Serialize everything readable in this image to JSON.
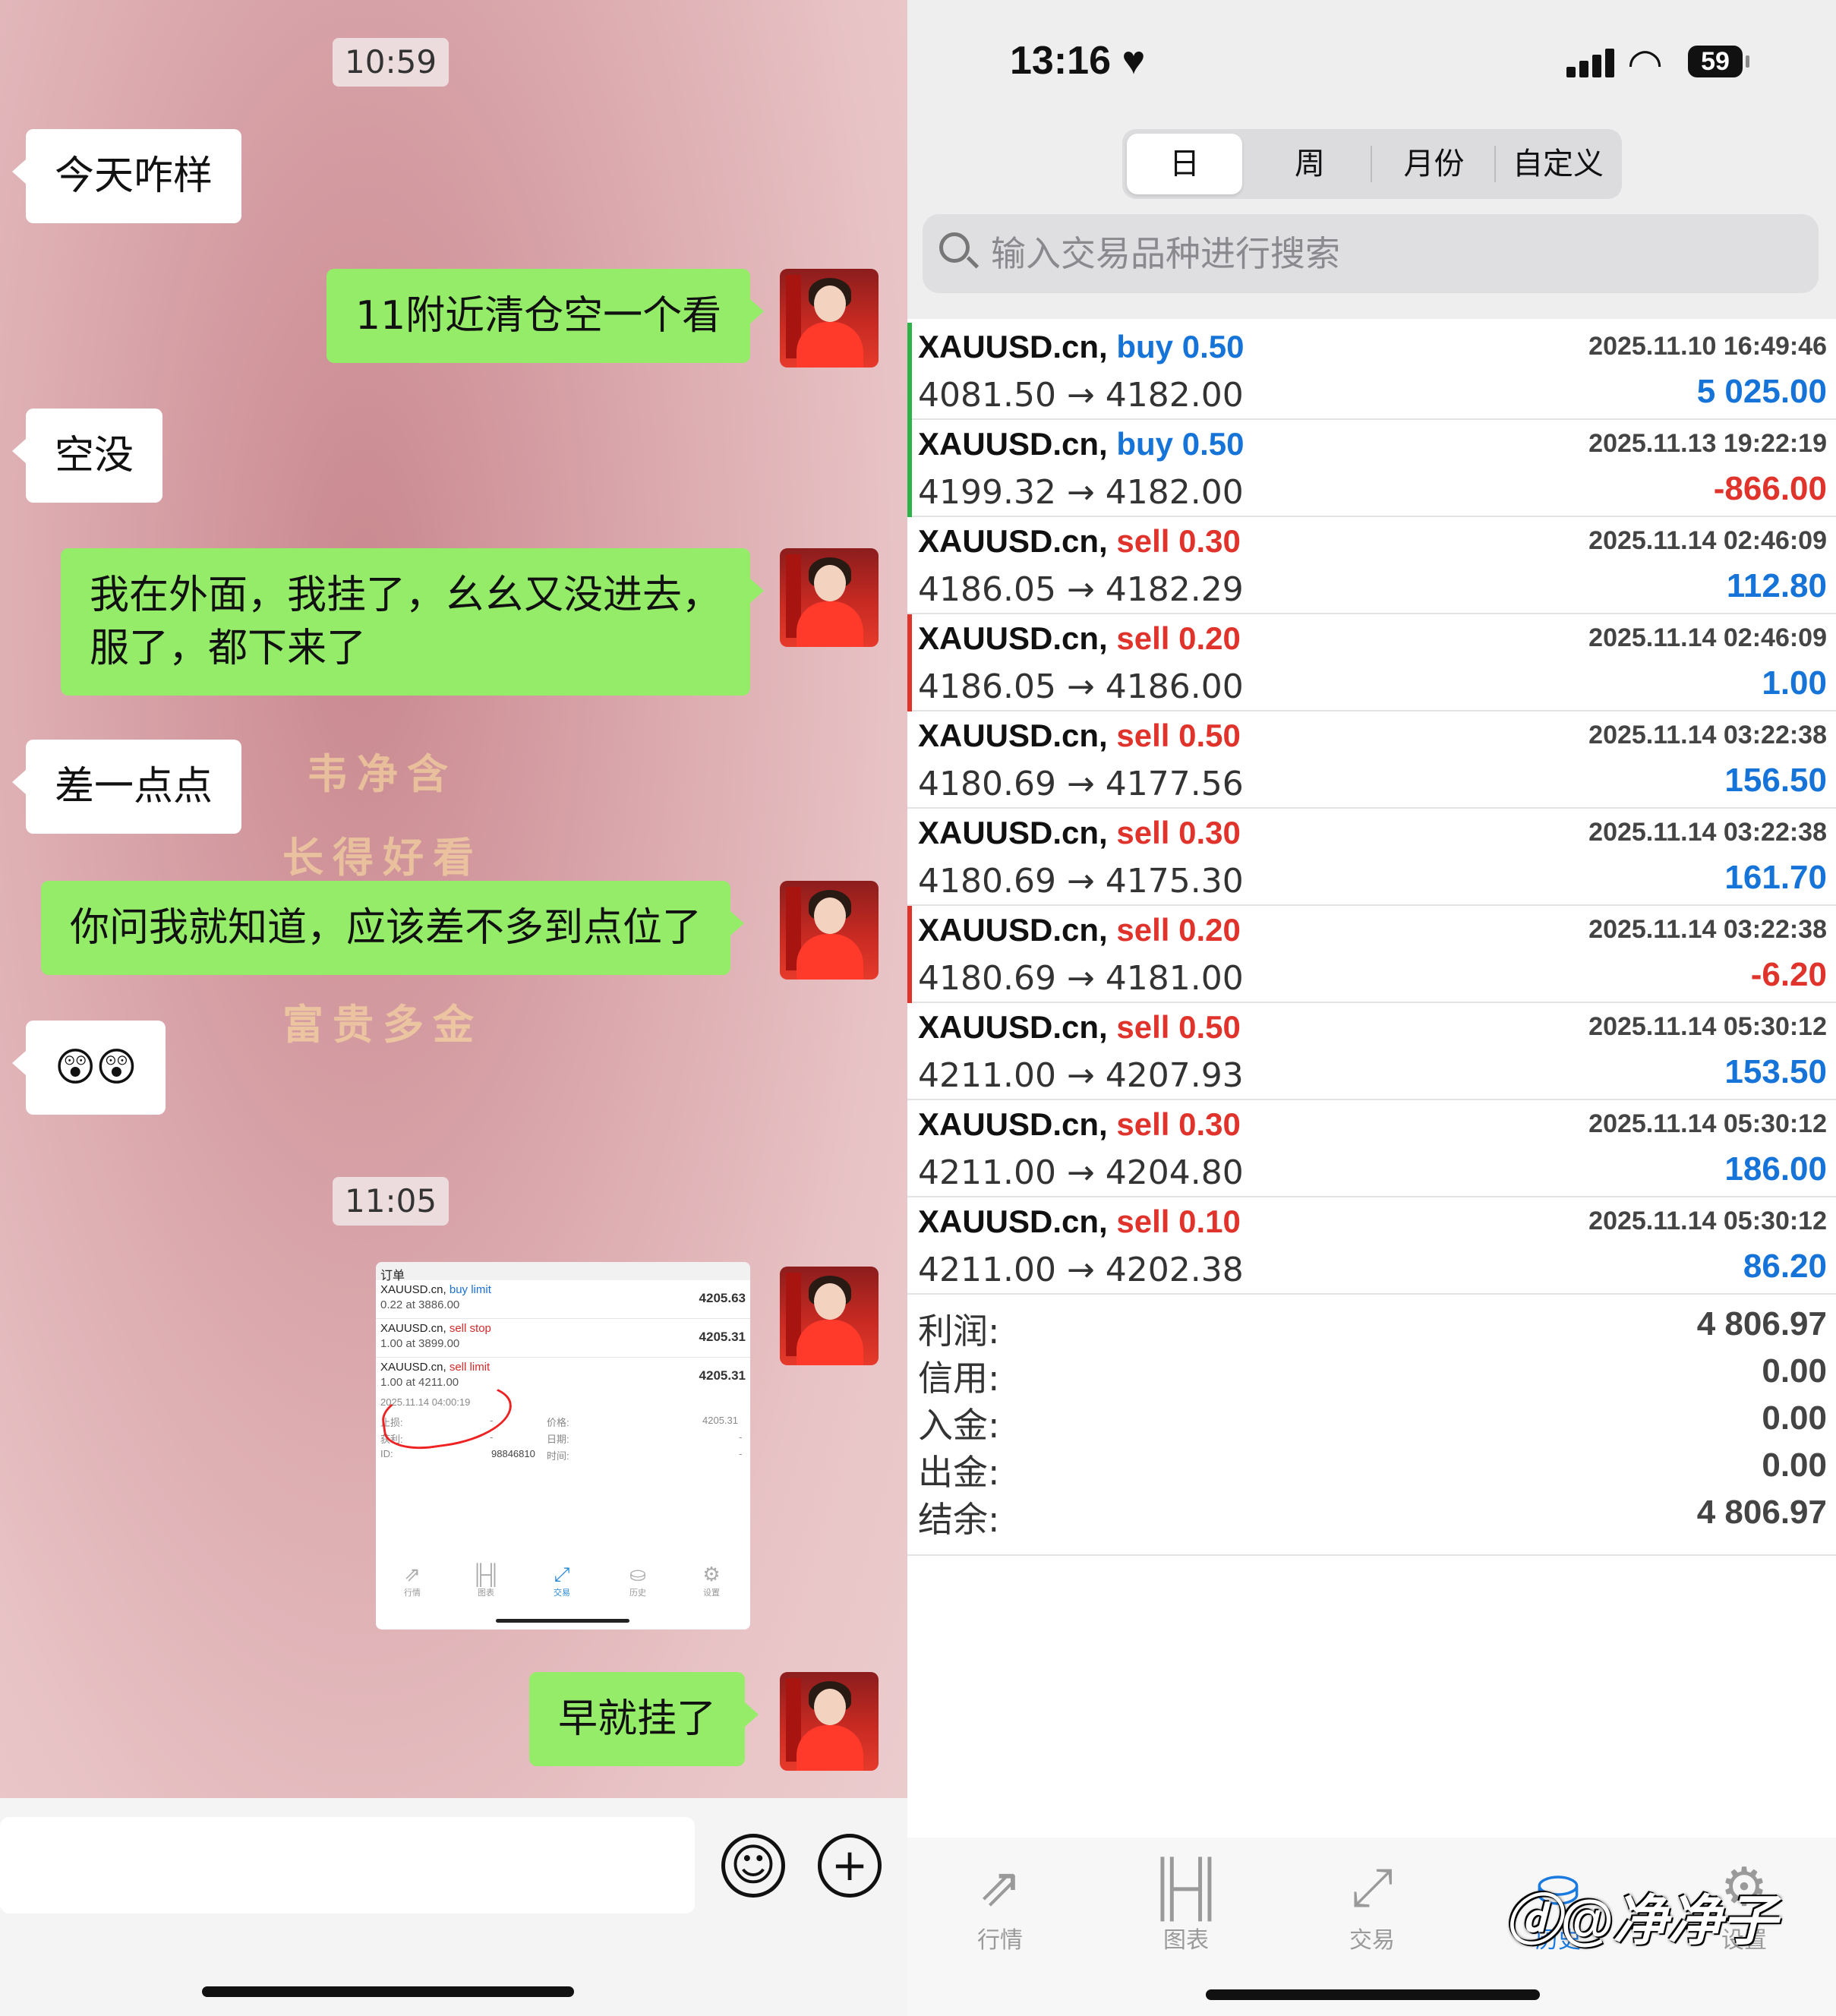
{
  "chat": {
    "times": [
      "10:59",
      "11:05"
    ],
    "messages": [
      {
        "side": "in",
        "text": "今天咋样"
      },
      {
        "side": "out",
        "text": "11附近清仓空一个看"
      },
      {
        "side": "in",
        "text": "空没"
      },
      {
        "side": "out",
        "text": "我在外面，我挂了，幺幺又没进去，\n服了，都下来了"
      },
      {
        "side": "in",
        "text": "差一点点"
      },
      {
        "side": "out",
        "text": "你问我就知道，应该差不多到点位了"
      },
      {
        "side": "in",
        "text": "😲😲"
      },
      {
        "side": "out",
        "text": "早就挂了"
      }
    ],
    "decor_text": [
      "韦净含",
      "长得好看",
      "富贵多金"
    ],
    "embedded_screenshot": {
      "title": "订单",
      "orders": [
        {
          "symbol": "XAUUSD.cn,",
          "type": "buy limit",
          "sub": "0.22 at 3886.00",
          "price": "4205.63"
        },
        {
          "symbol": "XAUUSD.cn,",
          "type": "sell stop",
          "sub": "1.00 at 3899.00",
          "price": "4205.31"
        },
        {
          "symbol": "XAUUSD.cn,",
          "type": "sell limit",
          "sub": "1.00 at 4211.00",
          "price": "4205.31"
        }
      ],
      "detail": {
        "date": "2025.11.14 04:00:19",
        "sl_label": "止损:",
        "tp_label": "获利:",
        "id_label": "ID:",
        "id_value": "98846810",
        "price_label": "价格:",
        "price_value": "4205.31",
        "date_label": "日期:",
        "time_label": "时间:",
        "dash": "-"
      },
      "tabs": [
        "行情",
        "图表",
        "交易",
        "历史",
        "设置"
      ]
    },
    "input_buttons": {
      "emoji": "☺",
      "plus": "+"
    }
  },
  "app": {
    "status": {
      "time": "13:16",
      "heart": "♥",
      "battery": "59",
      "wifi": "◠"
    },
    "segments": [
      "日",
      "周",
      "月份",
      "自定义"
    ],
    "active_segment": 0,
    "search_placeholder": "输入交易品种进行搜索",
    "deals": [
      {
        "symbol": "XAUUSD.cn,",
        "type": "buy 0.50",
        "side": "buy",
        "prices": "4081.50 → 4182.00",
        "datetime": "2025.11.10 16:49:46",
        "profit": "5 025.00",
        "positive": true,
        "marker": "#2bb34a"
      },
      {
        "symbol": "XAUUSD.cn,",
        "type": "buy 0.50",
        "side": "buy",
        "prices": "4199.32 → 4182.00",
        "datetime": "2025.11.13 19:22:19",
        "profit": "-866.00",
        "positive": false,
        "marker": "#2bb34a"
      },
      {
        "symbol": "XAUUSD.cn,",
        "type": "sell 0.30",
        "side": "sell",
        "prices": "4186.05 → 4182.29",
        "datetime": "2025.11.14 02:46:09",
        "profit": "112.80",
        "positive": true,
        "marker": ""
      },
      {
        "symbol": "XAUUSD.cn,",
        "type": "sell 0.20",
        "side": "sell",
        "prices": "4186.05 → 4186.00",
        "datetime": "2025.11.14 02:46:09",
        "profit": "1.00",
        "positive": true,
        "marker": "#e0332b"
      },
      {
        "symbol": "XAUUSD.cn,",
        "type": "sell 0.50",
        "side": "sell",
        "prices": "4180.69 → 4177.56",
        "datetime": "2025.11.14 03:22:38",
        "profit": "156.50",
        "positive": true,
        "marker": ""
      },
      {
        "symbol": "XAUUSD.cn,",
        "type": "sell 0.30",
        "side": "sell",
        "prices": "4180.69 → 4175.30",
        "datetime": "2025.11.14 03:22:38",
        "profit": "161.70",
        "positive": true,
        "marker": ""
      },
      {
        "symbol": "XAUUSD.cn,",
        "type": "sell 0.20",
        "side": "sell",
        "prices": "4180.69 → 4181.00",
        "datetime": "2025.11.14 03:22:38",
        "profit": "-6.20",
        "positive": false,
        "marker": "#e0332b"
      },
      {
        "symbol": "XAUUSD.cn,",
        "type": "sell 0.50",
        "side": "sell",
        "prices": "4211.00 → 4207.93",
        "datetime": "2025.11.14 05:30:12",
        "profit": "153.50",
        "positive": true,
        "marker": ""
      },
      {
        "symbol": "XAUUSD.cn,",
        "type": "sell 0.30",
        "side": "sell",
        "prices": "4211.00 → 4204.80",
        "datetime": "2025.11.14 05:30:12",
        "profit": "186.00",
        "positive": true,
        "marker": ""
      },
      {
        "symbol": "XAUUSD.cn,",
        "type": "sell 0.10",
        "side": "sell",
        "prices": "4211.00 → 4202.38",
        "datetime": "2025.11.14 05:30:12",
        "profit": "86.20",
        "positive": true,
        "marker": ""
      }
    ],
    "summary": [
      {
        "label": "利润:",
        "value": "4 806.97"
      },
      {
        "label": "信用:",
        "value": "0.00"
      },
      {
        "label": "入金:",
        "value": "0.00"
      },
      {
        "label": "出金:",
        "value": "0.00"
      },
      {
        "label": "结余:",
        "value": "4 806.97"
      }
    ],
    "tabs": [
      {
        "label": "行情",
        "icon": "⇗"
      },
      {
        "label": "图表",
        "icon": "╟╢"
      },
      {
        "label": "交易",
        "icon": "⤢"
      },
      {
        "label": "历史",
        "icon": "⛀"
      },
      {
        "label": "设置",
        "icon": "⚙"
      }
    ],
    "active_tab": 3,
    "watermark": "ⓓ@净净子"
  },
  "colors": {
    "buy": "#1674d9",
    "sell": "#e0332b",
    "wechat_green": "#95ec69",
    "tab_active": "#1a7ae0"
  }
}
